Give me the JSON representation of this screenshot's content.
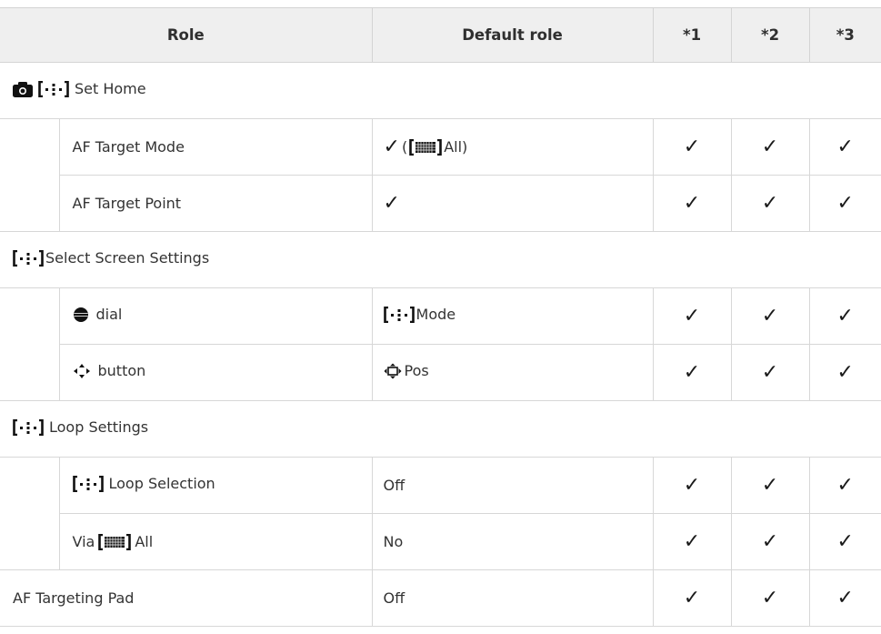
{
  "header": {
    "role": "Role",
    "default_role": "Default role",
    "col1": "*1",
    "col2": "*2",
    "col3": "*3"
  },
  "check_glyph": "✓",
  "icons": {
    "camera": "camera-icon",
    "af_target": "af-target-icon",
    "grid_all": "af-grid-all-icon",
    "dial": "dial-icon",
    "multi_selector": "multi-selector-icon",
    "multi_selector_pos": "multi-selector-pos-icon"
  },
  "sections": {
    "set_home": "Set Home",
    "select_screen": "Select Screen Settings",
    "loop_settings": "Loop Settings"
  },
  "rows": {
    "af_target_mode": {
      "role": "AF Target Mode",
      "default_open": "(",
      "default_text": "All)"
    },
    "af_target_point": {
      "role": "AF Target Point"
    },
    "dial": {
      "role": "dial",
      "default_text": "Mode"
    },
    "button": {
      "role": "button",
      "default_text": "Pos"
    },
    "loop_selection": {
      "role": "Loop Selection",
      "default_text": "Off"
    },
    "via_all": {
      "role_prefix": "Via",
      "role_suffix": "All",
      "default_text": "No"
    },
    "af_targeting_pad": {
      "role": "AF Targeting Pad",
      "default_text": "Off"
    }
  }
}
